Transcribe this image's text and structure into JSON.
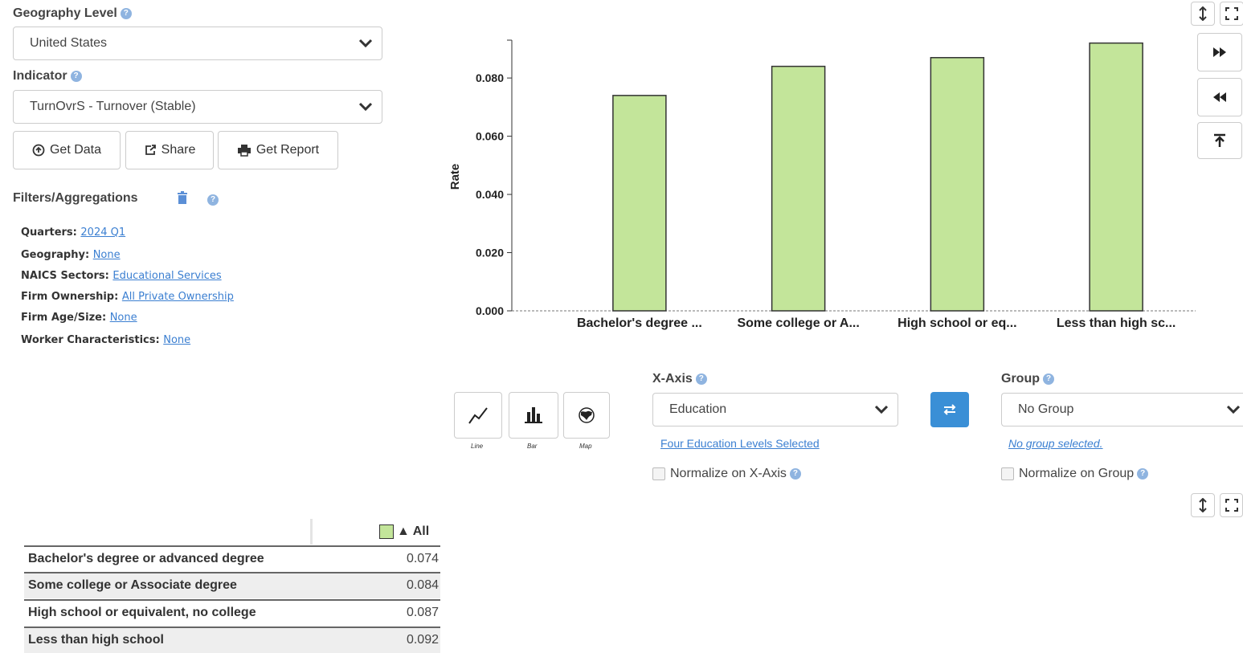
{
  "geography": {
    "label": "Geography Level",
    "value": "United States"
  },
  "indicator": {
    "label": "Indicator",
    "value": "TurnOvrS - Turnover (Stable)"
  },
  "actions": {
    "get_data": "Get Data",
    "share": "Share",
    "get_report": "Get Report"
  },
  "filters": {
    "title": "Filters/Aggregations",
    "items": [
      {
        "key": "Quarters:",
        "value": "2024 Q1"
      },
      {
        "key": "Geography:",
        "value": "None"
      },
      {
        "key": "NAICS Sectors:",
        "value": "Educational Services"
      },
      {
        "key": "Firm Ownership:",
        "value": "All Private Ownership"
      },
      {
        "key": "Firm Age/Size:",
        "value": "None"
      },
      {
        "key": "Worker Characteristics:",
        "value": "None"
      }
    ]
  },
  "chart_data": {
    "type": "bar",
    "categories": [
      "Bachelor's degree ...",
      "Some college or A...",
      "High school or eq...",
      "Less than high sc..."
    ],
    "values": [
      0.074,
      0.084,
      0.087,
      0.092
    ],
    "ylabel": "Rate",
    "yticks": [
      "0.000",
      "0.020",
      "0.040",
      "0.060",
      "0.080"
    ],
    "ylim": [
      0,
      0.093
    ],
    "bar_color": "#c3e59a",
    "bar_stroke": "#333333"
  },
  "chart_types": {
    "line": "Line",
    "bar": "Bar",
    "map": "Map"
  },
  "xaxis": {
    "label": "X-Axis",
    "value": "Education",
    "link": "Four Education Levels Selected",
    "normalize": "Normalize on X-Axis"
  },
  "group": {
    "label": "Group",
    "value": "No Group",
    "link": "No group selected.",
    "normalize": "Normalize on Group"
  },
  "table": {
    "header": "▲ All",
    "rows": [
      {
        "name": "Bachelor's degree or advanced degree",
        "value": "0.074"
      },
      {
        "name": "Some college or Associate degree",
        "value": "0.084"
      },
      {
        "name": "High school or equivalent, no college",
        "value": "0.087"
      },
      {
        "name": "Less than high school",
        "value": "0.092"
      }
    ]
  },
  "colors": {
    "accent": "#3a8fd6",
    "link": "#3b7fd1",
    "swap_button": "#3a8fd6"
  }
}
